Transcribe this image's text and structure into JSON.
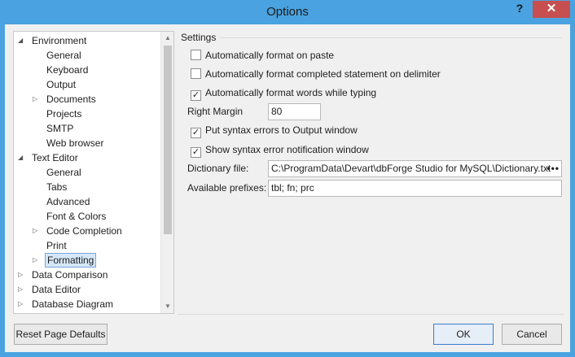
{
  "window": {
    "title": "Options",
    "help_glyph": "?",
    "close_glyph": "✕"
  },
  "tree": {
    "items": [
      {
        "label": "Environment",
        "level": 0,
        "expander": "◢"
      },
      {
        "label": "General",
        "level": 1
      },
      {
        "label": "Keyboard",
        "level": 1
      },
      {
        "label": "Output",
        "level": 1
      },
      {
        "label": "Documents",
        "level": 1,
        "expander": "▷"
      },
      {
        "label": "Projects",
        "level": 1
      },
      {
        "label": "SMTP",
        "level": 1
      },
      {
        "label": "Web browser",
        "level": 1
      },
      {
        "label": "Text Editor",
        "level": 0,
        "expander": "◢"
      },
      {
        "label": "General",
        "level": 1
      },
      {
        "label": "Tabs",
        "level": 1
      },
      {
        "label": "Advanced",
        "level": 1
      },
      {
        "label": "Font & Colors",
        "level": 1
      },
      {
        "label": "Code Completion",
        "level": 1,
        "expander": "▷"
      },
      {
        "label": "Print",
        "level": 1
      },
      {
        "label": "Formatting",
        "level": 1,
        "expander": "▷",
        "selected": true
      },
      {
        "label": "Data Comparison",
        "level": 0,
        "expander": "▷"
      },
      {
        "label": "Data Editor",
        "level": 0,
        "expander": "▷"
      },
      {
        "label": "Database Diagram",
        "level": 0,
        "expander": "▷"
      }
    ]
  },
  "settings": {
    "group_title": "Settings",
    "checks": [
      {
        "label": "Automatically format on paste",
        "checked": false
      },
      {
        "label": "Automatically format completed statement on delimiter",
        "checked": false
      },
      {
        "label": "Automatically format words while typing",
        "checked": true
      },
      {
        "label": "Put syntax errors to Output window",
        "checked": true
      },
      {
        "label": "Show syntax error notification window",
        "checked": true
      }
    ],
    "right_margin_label": "Right Margin",
    "right_margin_value": "80",
    "dictionary_label": "Dictionary file:",
    "dictionary_value": "C:\\ProgramData\\Devart\\dbForge Studio for MySQL\\Dictionary.txt",
    "dictionary_browse": "•••",
    "prefixes_label": "Available prefixes:",
    "prefixes_value": "tbl; fn; prc"
  },
  "buttons": {
    "reset": "Reset Page Defaults",
    "ok": "OK",
    "cancel": "Cancel"
  }
}
